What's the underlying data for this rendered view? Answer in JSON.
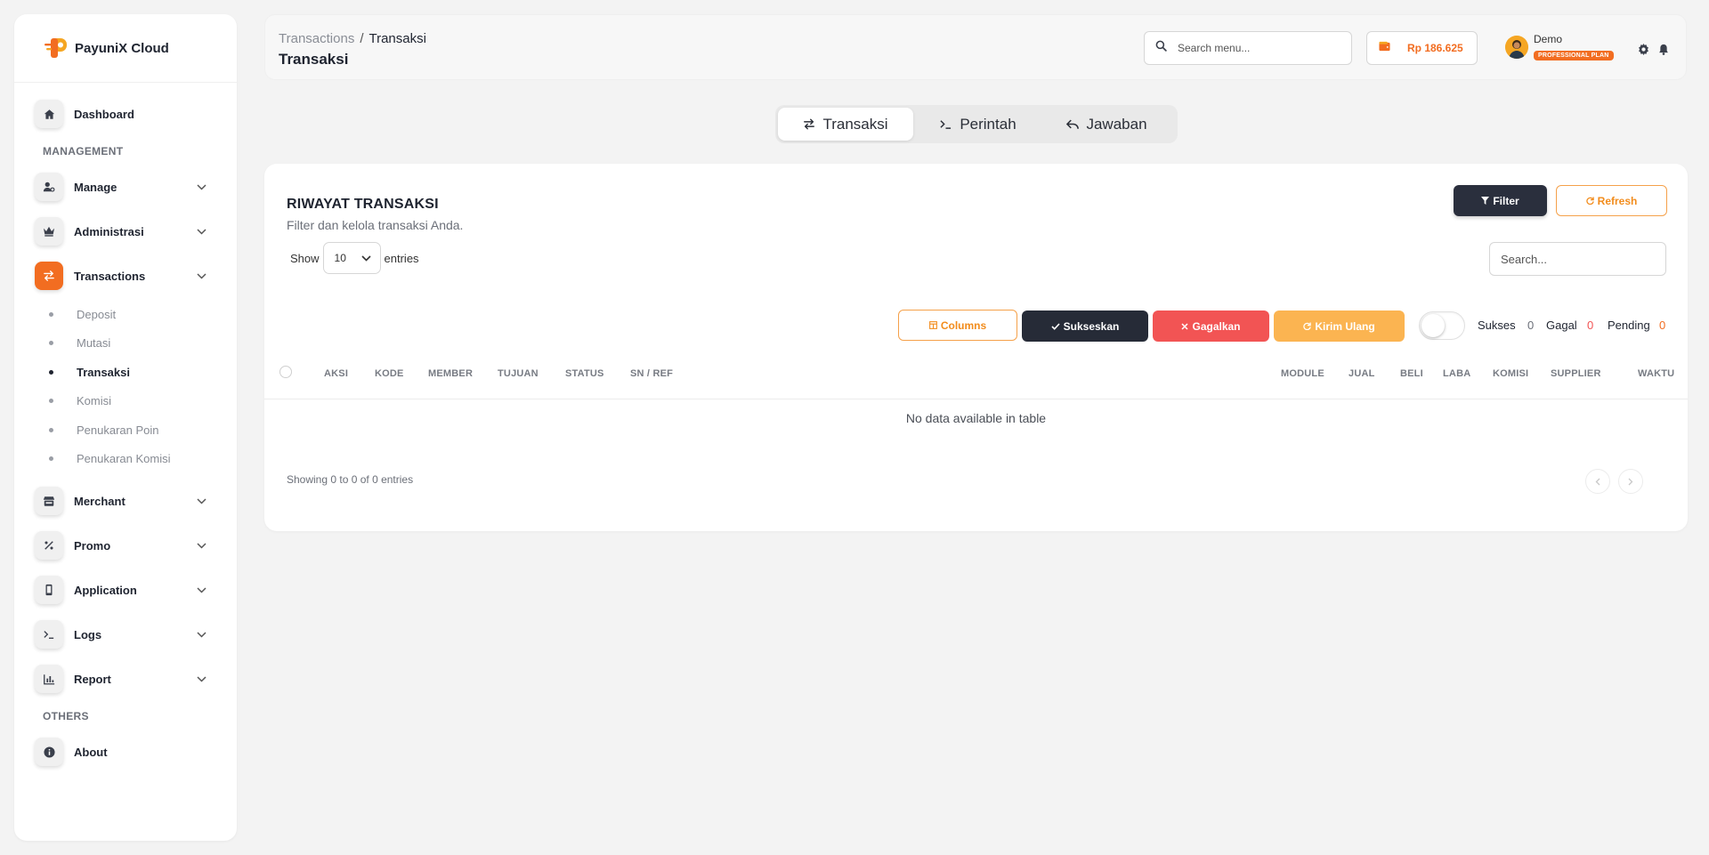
{
  "app": {
    "brand": "PayuniX Cloud"
  },
  "sidebar": {
    "dashboard": "Dashboard",
    "section_management": "MANAGEMENT",
    "section_others": "OTHERS",
    "items": {
      "manage": "Manage",
      "administrasi": "Administrasi",
      "transactions": "Transactions",
      "merchant": "Merchant",
      "promo": "Promo",
      "application": "Application",
      "logs": "Logs",
      "report": "Report",
      "about": "About"
    },
    "sub_items": {
      "deposit": "Deposit",
      "mutasi": "Mutasi",
      "transaksi": "Transaksi",
      "komisi": "Komisi",
      "penukaran_poin": "Penukaran Poin",
      "penukaran_komisi": "Penukaran Komisi"
    }
  },
  "header": {
    "breadcrumb_parent": "Transactions",
    "breadcrumb_sep": "/",
    "breadcrumb_current": "Transaksi",
    "title": "Transaksi",
    "search_placeholder": "Search menu...",
    "balance": "Rp 186.625",
    "user_name": "Demo",
    "plan": "PROFESSIONAL PLAN"
  },
  "tabs": {
    "transaksi": "Transaksi",
    "perintah": "Perintah",
    "jawaban": "Jawaban"
  },
  "card": {
    "title": "RIWAYAT TRANSAKSI",
    "subtitle": "Filter dan kelola transaksi Anda.",
    "filter_label": "Filter",
    "refresh_label": "Refresh",
    "show_label": "Show",
    "entries_value": "10",
    "entries_label": "entries",
    "search_placeholder": "Search...",
    "columns_label": "Columns",
    "sukseskan_label": "Sukseskan",
    "gagalkan_label": "Gagalkan",
    "kirim_ulang_label": "Kirim Ulang",
    "stats": {
      "sukses_label": "Sukses",
      "sukses_value": "0",
      "gagal_label": "Gagal",
      "gagal_value": "0",
      "pending_label": "Pending",
      "pending_value": "0"
    },
    "columns": {
      "aksi": "AKSI",
      "kode": "KODE",
      "member": "MEMBER",
      "tujuan": "TUJUAN",
      "status": "STATUS",
      "sn_ref": "SN / REF",
      "module": "MODULE",
      "jual": "JUAL",
      "beli": "BELI",
      "laba": "LABA",
      "komisi": "KOMISI",
      "supplier": "SUPPLIER",
      "waktu": "WAKTU"
    },
    "empty_text": "No data available in table",
    "info_text": "Showing 0 to 0 of 0 entries"
  },
  "colors": {
    "accent": "#f26d21",
    "dark": "#262b37",
    "danger": "#f25454",
    "warning": "#fbb451"
  }
}
